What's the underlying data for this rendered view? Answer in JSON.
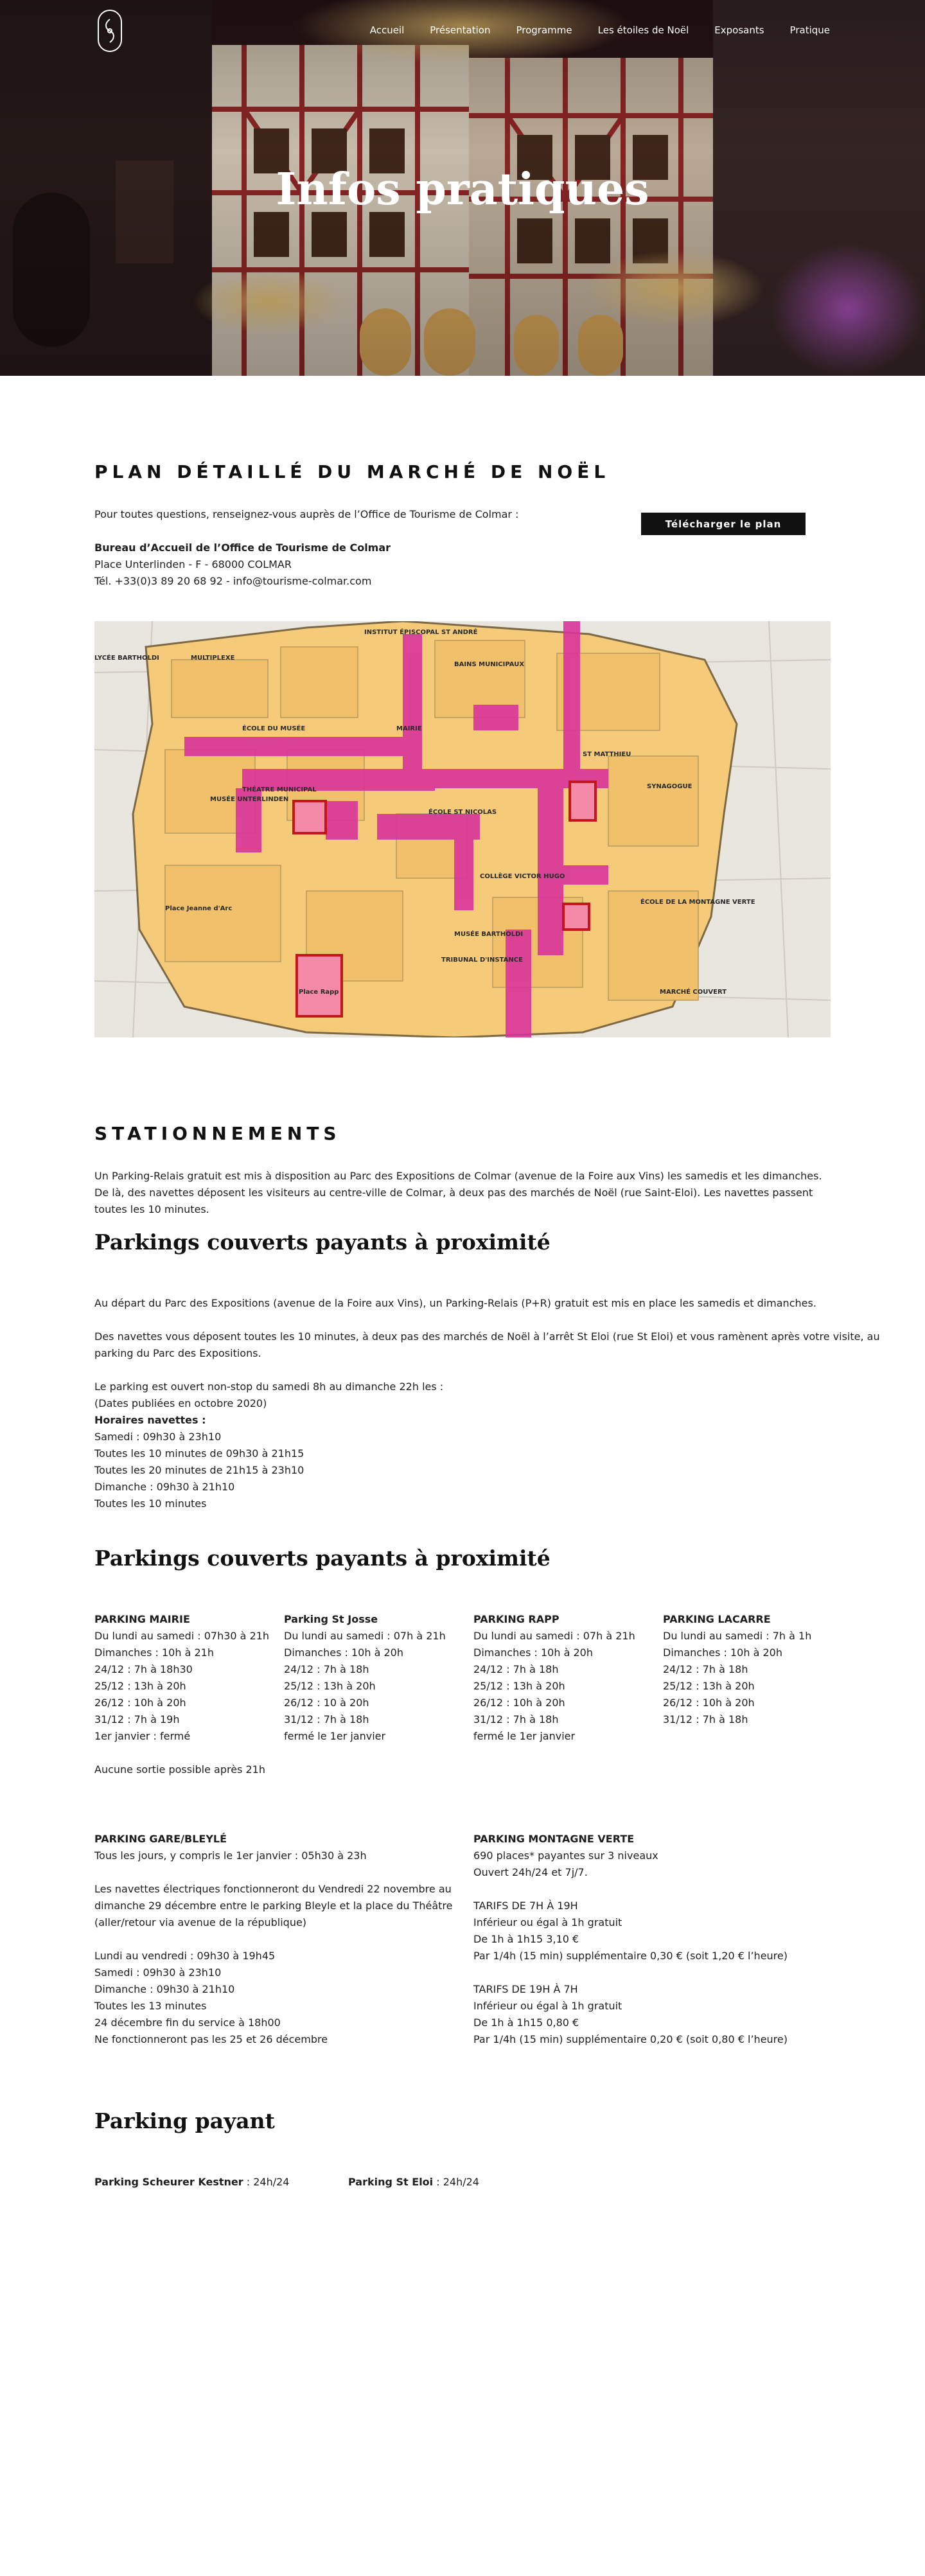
{
  "header": {
    "nav": [
      "Accueil",
      "Présentation",
      "Programme",
      "Les étoiles de Noël",
      "Exposants",
      "Pratique"
    ],
    "title": "Infos pratiques"
  },
  "plan": {
    "title": "PLAN DÉTAILLÉ DU MARCHÉ DE NOËL",
    "intro": "Pour toutes questions, renseignez-vous auprès de l’Office de Tourisme de Colmar :",
    "office_name": "Bureau d’Accueil de l’Office de Tourisme de Colmar",
    "office_address": "Place Unterlinden - F - 68000 COLMAR",
    "office_contact": "Tél. +33(0)3 89 20 68 92 - info@tourisme-colmar.com",
    "download_button": "Télécharger le plan",
    "map_labels": [
      "MULTIPLEXE",
      "LYCÉE BARTHOLDI",
      "INSTITUT ÉPISCOPAL ST ANDRÉ",
      "BAINS MUNICIPAUX",
      "MAIRIE",
      "ÉCOLE DU MUSÉE",
      "THÉATRE MUNICIPAL",
      "ÉCOLE ST NICOLAS",
      "MUSÉE UNTERLINDEN",
      "ST MATTHIEU",
      "SYNAGOGUE",
      "COLLÈGE VICTOR HUGO",
      "MUSÉE BARTHOLDI",
      "TRIBUNAL D'INSTANCE",
      "ÉCOLE DE LA MONTAGNE VERTE",
      "Place Jeanne d'Arc",
      "Place Rapp",
      "MARCHÉ COUVERT"
    ]
  },
  "stationnements": {
    "title": "STATIONNEMENTS",
    "text": "Un Parking-Relais gratuit est mis à disposition au Parc des Expositions de Colmar (avenue de la Foire aux Vins) les samedis et les dimanches. De là, des navettes déposent les visiteurs au centre-ville de Colmar, à deux pas des marchés de Noël (rue Saint-Eloi). Les navettes passent toutes les 10 minutes."
  },
  "parkings1": {
    "title": "Parkings couverts payants à proximité",
    "p1": "Au départ du Parc des Expositions (avenue de la Foire aux Vins), un Parking-Relais (P+R) gratuit est mis en place les samedis et dimanches.",
    "p2a": "Des navettes vous déposent toutes les 10 minutes, à deux pas des marchés de Noël à l’arrêt St Eloi (rue St Eloi) et vous ramènent après votre visite, au",
    "p2b": "parking du Parc des Expositions.",
    "lines": [
      "Le parking est ouvert non-stop du samedi 8h au dimanche 22h les :",
      "(Dates publiées en octobre 2020)"
    ],
    "horaires_label": "Horaires navettes :",
    "horaires": [
      "Samedi : 09h30 à 23h10",
      "Toutes les 10 minutes de 09h30 à 21h15",
      "Toutes les 20 minutes de 21h15 à 23h10",
      "Dimanche : 09h30 à 21h10",
      "Toutes les 10 minutes"
    ]
  },
  "parkings2": {
    "title": "Parkings couverts payants à proximité",
    "columns": [
      {
        "name": "PARKING MAIRIE",
        "lines": [
          "Du lundi au samedi : 07h30 à 21h",
          "Dimanches : 10h à 21h",
          "24/12 : 7h à 18h30",
          "25/12 : 13h à 20h",
          "26/12 : 10h à 20h",
          "31/12 : 7h à 19h",
          "1er janvier : fermé"
        ]
      },
      {
        "name": "Parking St Josse",
        "lines": [
          "Du lundi au samedi : 07h à 21h",
          "Dimanches : 10h à 20h",
          "24/12 : 7h à 18h",
          "25/12 : 13h à 20h",
          "26/12 : 10 à 20h",
          "31/12 : 7h à 18h",
          "fermé le 1er janvier"
        ]
      },
      {
        "name": "PARKING RAPP",
        "lines": [
          "Du lundi au samedi : 07h à 21h",
          "Dimanches : 10h à 20h",
          "24/12 : 7h à 18h",
          "25/12 : 13h à 20h",
          "26/12 : 10h à 20h",
          "31/12 : 7h à 18h",
          "fermé le 1er janvier"
        ]
      },
      {
        "name": "PARKING LACARRE",
        "lines": [
          "Du lundi au samedi : 7h à 1h",
          "Dimanches  : 10h à 20h",
          "24/12 : 7h à 18h",
          "25/12 : 13h à 20h",
          "26/12 : 10h à 20h",
          "31/12 : 7h à 18h"
        ]
      }
    ],
    "note": "Aucune sortie possible après 21h",
    "gare": {
      "name": "PARKING GARE/BLEYLÉ",
      "lines": [
        "Tous les jours, y compris le 1er janvier : 05h30 à 23h",
        "",
        "Les navettes électriques fonctionneront du Vendredi 22 novembre au",
        "dimanche 29 décembre entre le parking Bleyle et la place du Théâtre",
        "(aller/retour via avenue de la république)",
        "",
        "Lundi au vendredi : 09h30 à 19h45",
        "Samedi : 09h30 à 23h10",
        "Dimanche : 09h30 à 21h10",
        "Toutes les 13 minutes",
        "24 décembre fin du service à 18h00",
        "Ne fonctionneront pas les 25 et 26 décembre"
      ]
    },
    "montagne": {
      "name": "PARKING MONTAGNE VERTE",
      "lines": [
        "690 places* payantes sur 3 niveaux",
        "Ouvert 24h/24 et 7j/7.",
        "",
        "TARIFS DE 7H À 19H",
        "Inférieur ou égal à 1h gratuit",
        "De 1h à 1h15 3,10 €",
        "Par 1/4h (15 min) supplémentaire 0,30 € (soit 1,20 € l’heure)",
        "",
        "TARIFS DE 19H À 7H",
        "Inférieur ou égal à 1h gratuit",
        "De 1h à 1h15 0,80 €",
        "Par 1/4h (15 min) supplémentaire 0,20 € (soit 0,80 € l’heure)"
      ]
    }
  },
  "payant": {
    "title": "Parking payant",
    "items": [
      {
        "name": "Parking Scheurer Kestner",
        "value": " : 24h/24"
      },
      {
        "name": "Parking St Eloi",
        "value": " : 24h/24"
      }
    ]
  }
}
